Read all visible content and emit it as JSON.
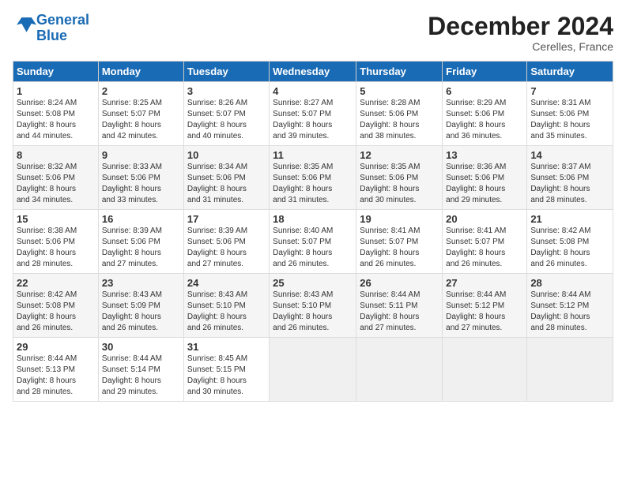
{
  "header": {
    "logo_line1": "General",
    "logo_line2": "Blue",
    "month_title": "December 2024",
    "location": "Cerelles, France"
  },
  "days_of_week": [
    "Sunday",
    "Monday",
    "Tuesday",
    "Wednesday",
    "Thursday",
    "Friday",
    "Saturday"
  ],
  "weeks": [
    [
      {
        "day": 1,
        "info": "Sunrise: 8:24 AM\nSunset: 5:08 PM\nDaylight: 8 hours\nand 44 minutes."
      },
      {
        "day": 2,
        "info": "Sunrise: 8:25 AM\nSunset: 5:07 PM\nDaylight: 8 hours\nand 42 minutes."
      },
      {
        "day": 3,
        "info": "Sunrise: 8:26 AM\nSunset: 5:07 PM\nDaylight: 8 hours\nand 40 minutes."
      },
      {
        "day": 4,
        "info": "Sunrise: 8:27 AM\nSunset: 5:07 PM\nDaylight: 8 hours\nand 39 minutes."
      },
      {
        "day": 5,
        "info": "Sunrise: 8:28 AM\nSunset: 5:06 PM\nDaylight: 8 hours\nand 38 minutes."
      },
      {
        "day": 6,
        "info": "Sunrise: 8:29 AM\nSunset: 5:06 PM\nDaylight: 8 hours\nand 36 minutes."
      },
      {
        "day": 7,
        "info": "Sunrise: 8:31 AM\nSunset: 5:06 PM\nDaylight: 8 hours\nand 35 minutes."
      }
    ],
    [
      {
        "day": 8,
        "info": "Sunrise: 8:32 AM\nSunset: 5:06 PM\nDaylight: 8 hours\nand 34 minutes."
      },
      {
        "day": 9,
        "info": "Sunrise: 8:33 AM\nSunset: 5:06 PM\nDaylight: 8 hours\nand 33 minutes."
      },
      {
        "day": 10,
        "info": "Sunrise: 8:34 AM\nSunset: 5:06 PM\nDaylight: 8 hours\nand 31 minutes."
      },
      {
        "day": 11,
        "info": "Sunrise: 8:35 AM\nSunset: 5:06 PM\nDaylight: 8 hours\nand 31 minutes."
      },
      {
        "day": 12,
        "info": "Sunrise: 8:35 AM\nSunset: 5:06 PM\nDaylight: 8 hours\nand 30 minutes."
      },
      {
        "day": 13,
        "info": "Sunrise: 8:36 AM\nSunset: 5:06 PM\nDaylight: 8 hours\nand 29 minutes."
      },
      {
        "day": 14,
        "info": "Sunrise: 8:37 AM\nSunset: 5:06 PM\nDaylight: 8 hours\nand 28 minutes."
      }
    ],
    [
      {
        "day": 15,
        "info": "Sunrise: 8:38 AM\nSunset: 5:06 PM\nDaylight: 8 hours\nand 28 minutes."
      },
      {
        "day": 16,
        "info": "Sunrise: 8:39 AM\nSunset: 5:06 PM\nDaylight: 8 hours\nand 27 minutes."
      },
      {
        "day": 17,
        "info": "Sunrise: 8:39 AM\nSunset: 5:06 PM\nDaylight: 8 hours\nand 27 minutes."
      },
      {
        "day": 18,
        "info": "Sunrise: 8:40 AM\nSunset: 5:07 PM\nDaylight: 8 hours\nand 26 minutes."
      },
      {
        "day": 19,
        "info": "Sunrise: 8:41 AM\nSunset: 5:07 PM\nDaylight: 8 hours\nand 26 minutes."
      },
      {
        "day": 20,
        "info": "Sunrise: 8:41 AM\nSunset: 5:07 PM\nDaylight: 8 hours\nand 26 minutes."
      },
      {
        "day": 21,
        "info": "Sunrise: 8:42 AM\nSunset: 5:08 PM\nDaylight: 8 hours\nand 26 minutes."
      }
    ],
    [
      {
        "day": 22,
        "info": "Sunrise: 8:42 AM\nSunset: 5:08 PM\nDaylight: 8 hours\nand 26 minutes."
      },
      {
        "day": 23,
        "info": "Sunrise: 8:43 AM\nSunset: 5:09 PM\nDaylight: 8 hours\nand 26 minutes."
      },
      {
        "day": 24,
        "info": "Sunrise: 8:43 AM\nSunset: 5:10 PM\nDaylight: 8 hours\nand 26 minutes."
      },
      {
        "day": 25,
        "info": "Sunrise: 8:43 AM\nSunset: 5:10 PM\nDaylight: 8 hours\nand 26 minutes."
      },
      {
        "day": 26,
        "info": "Sunrise: 8:44 AM\nSunset: 5:11 PM\nDaylight: 8 hours\nand 27 minutes."
      },
      {
        "day": 27,
        "info": "Sunrise: 8:44 AM\nSunset: 5:12 PM\nDaylight: 8 hours\nand 27 minutes."
      },
      {
        "day": 28,
        "info": "Sunrise: 8:44 AM\nSunset: 5:12 PM\nDaylight: 8 hours\nand 28 minutes."
      }
    ],
    [
      {
        "day": 29,
        "info": "Sunrise: 8:44 AM\nSunset: 5:13 PM\nDaylight: 8 hours\nand 28 minutes."
      },
      {
        "day": 30,
        "info": "Sunrise: 8:44 AM\nSunset: 5:14 PM\nDaylight: 8 hours\nand 29 minutes."
      },
      {
        "day": 31,
        "info": "Sunrise: 8:45 AM\nSunset: 5:15 PM\nDaylight: 8 hours\nand 30 minutes."
      },
      null,
      null,
      null,
      null
    ]
  ]
}
